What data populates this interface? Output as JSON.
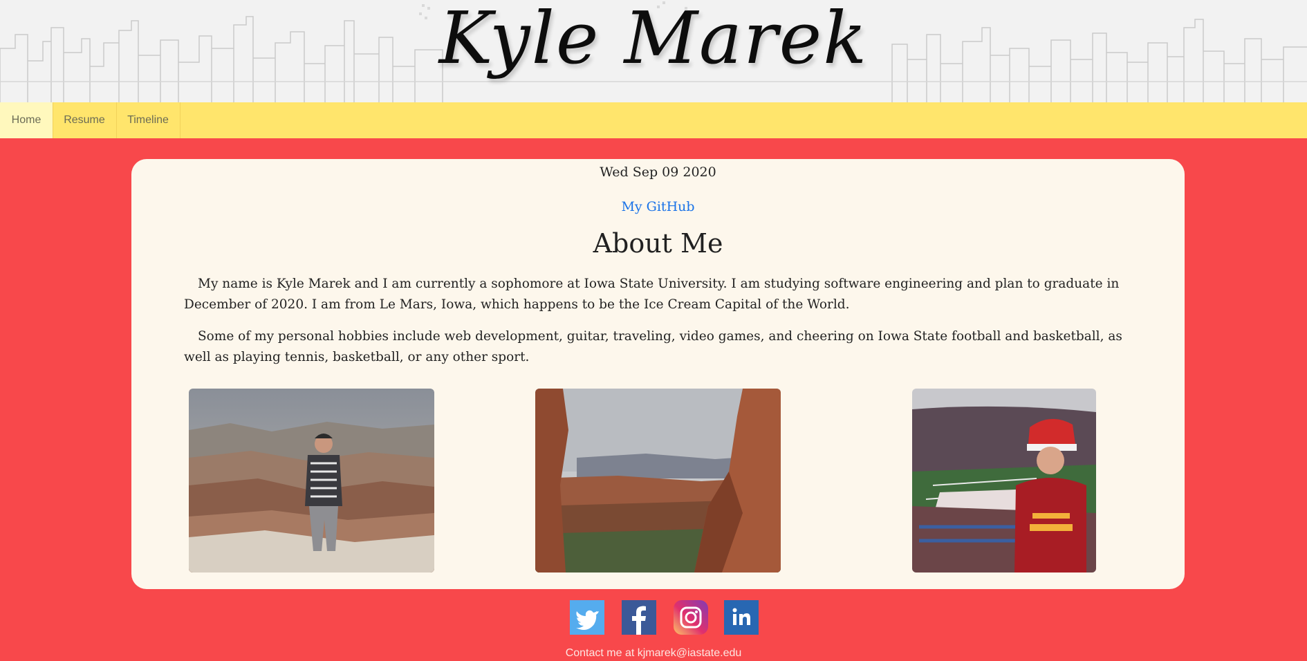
{
  "header": {
    "title": "Kyle Marek"
  },
  "nav": {
    "items": [
      {
        "label": "Home",
        "active": true
      },
      {
        "label": "Resume",
        "active": false
      },
      {
        "label": "Timeline",
        "active": false
      }
    ]
  },
  "main": {
    "date": "Wed Sep 09 2020",
    "github_link": "My GitHub",
    "heading": "About Me",
    "paragraphs": [
      "My name is Kyle Marek and I am currently a sophomore at Iowa State University. I am studying software engineering and plan to graduate in December of 2020. I am from Le Mars, Iowa, which happens to be the Ice Cream Capital of the World.",
      "Some of my personal hobbies include web development, guitar, traveling, video games, and cheering on Iowa State football and basketball, as well as playing tennis, basketball, or any other sport."
    ],
    "photos": [
      {
        "icon": "grand-canyon-photo"
      },
      {
        "icon": "red-rock-canyon-photo"
      },
      {
        "icon": "stadium-photo"
      }
    ]
  },
  "footer": {
    "social": [
      {
        "icon": "twitter-icon",
        "color": "#55acee"
      },
      {
        "icon": "facebook-icon",
        "color": "#3b5998"
      },
      {
        "icon": "instagram-icon",
        "color": "#c13584"
      },
      {
        "icon": "linkedin-icon",
        "color": "#2867b2"
      }
    ],
    "contact": "Contact me at kjmarek@iastate.edu"
  },
  "colors": {
    "page_background": "#f8484b",
    "nav_background": "#ffe56c",
    "card_background": "#fdf7ec",
    "link": "#1a73e8"
  }
}
